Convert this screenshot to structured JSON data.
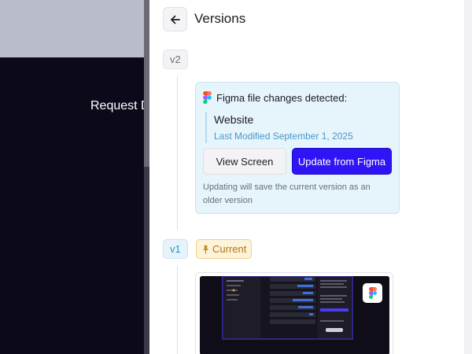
{
  "background": {
    "request_text": "Request D"
  },
  "drawer": {
    "title": "Versions",
    "back_icon": "arrow-left-icon"
  },
  "versions": [
    {
      "label": "v2",
      "card": {
        "heading": "Figma file changes detected:",
        "file_name": "Website",
        "last_modified": "Last Modified September 1, 2025",
        "view_button": "View Screen",
        "update_button": "Update from Figma",
        "note": "Updating will save the current version as an older version"
      }
    },
    {
      "label": "v1",
      "current_badge": "Current",
      "pin_icon": "pin-icon",
      "preview_icon": "figma-icon"
    }
  ],
  "colors": {
    "accent": "#2f14f5",
    "card_bg": "#e6f4fb",
    "current_badge": "#b3780d",
    "v1_badge": "#2f8fc8"
  }
}
